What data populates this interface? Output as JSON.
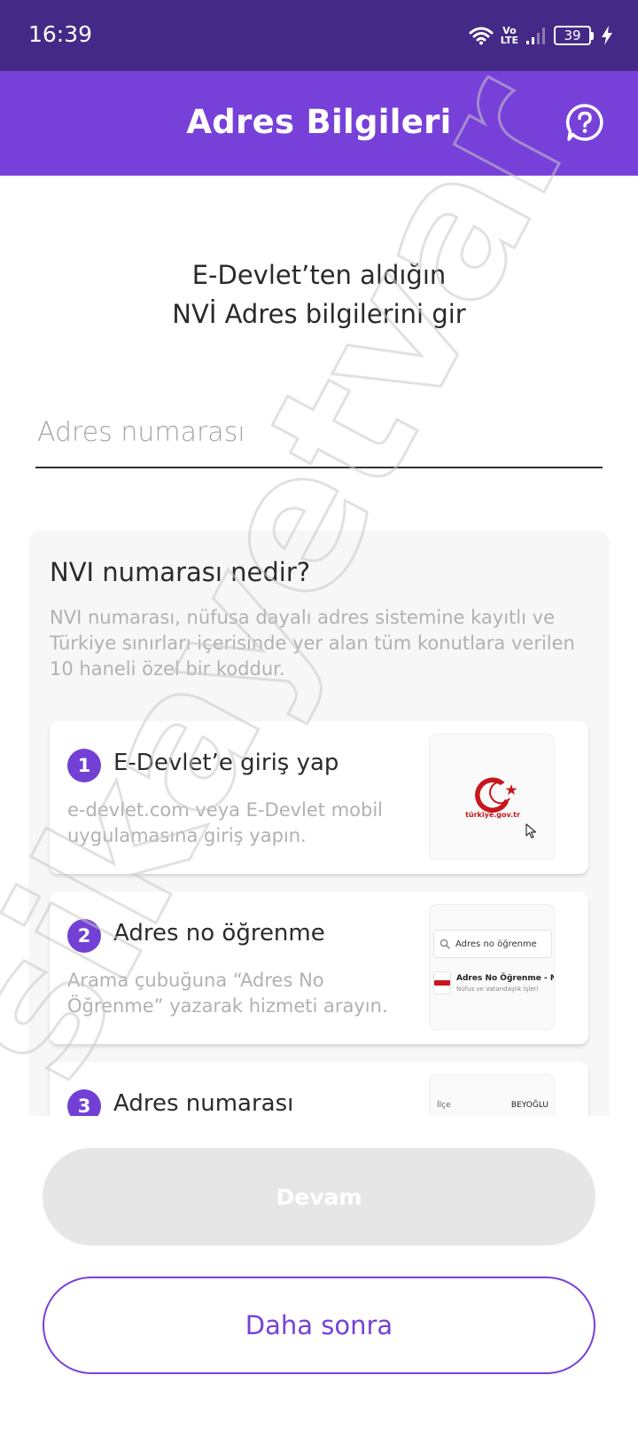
{
  "status_bar": {
    "time": "16:39",
    "network_top": "Vo",
    "network_bottom": "LTE",
    "battery": "39",
    "icons": [
      "wifi-icon",
      "signal-icon",
      "battery-icon",
      "charging-icon"
    ]
  },
  "app_bar": {
    "title": "Adres Bilgileri",
    "help_icon": "help-chat-icon"
  },
  "heading": {
    "line1": "E-Devlet’ten aldığın",
    "line2": "NVİ Adres bilgilerini gir"
  },
  "address_input": {
    "placeholder": "Adres numarası",
    "value": ""
  },
  "info_card": {
    "title": "NVI numarası nedir?",
    "description": "NVI numarası, nüfusa dayalı adres sistemine kayıtlı ve Türkiye sınırları içerisinde yer alan tüm konutlara verilen 10 haneli özel bir koddur.",
    "steps": [
      {
        "number": "1",
        "title": "E-Devlet’e giriş yap",
        "description": "e-devlet.com veya E-Devlet mobil uygulamasına giriş yapın.",
        "thumb": {
          "logo_text": "türkiye.gov.tr"
        }
      },
      {
        "number": "2",
        "title": "Adres no öğrenme",
        "description": "Arama çubuğuna “Adres No Öğrenme” yazarak hizmeti arayın.",
        "thumb": {
          "search_text": "Adres no öğrenme",
          "result_title": "Adres No Öğrenme - NVİ",
          "result_subtitle": "Nüfus ve Vatandaşlık İşleri"
        }
      },
      {
        "number": "3",
        "title": "Adres numarası",
        "description": "",
        "thumb": {
          "row_key": "İlçe",
          "row_value": "BEYOĞLU"
        }
      }
    ]
  },
  "buttons": {
    "continue": "Devam",
    "later": "Daha sonra"
  },
  "colors": {
    "status_bar": "#442a86",
    "brand": "#7741d9",
    "step_badge": "#7340d6",
    "disabled_button": "#e6e6e6",
    "muted_text": "#b1b1b1",
    "edevlet_red": "#c8161d"
  },
  "watermark_text": "sikayetvar"
}
